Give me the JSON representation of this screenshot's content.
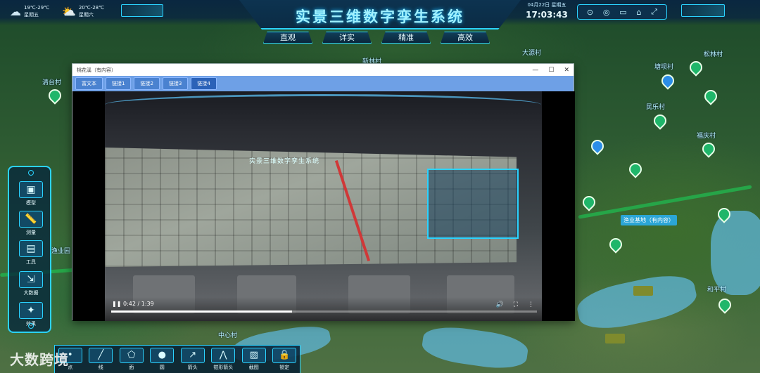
{
  "header": {
    "title": "实景三维数字孪生系统",
    "weather": [
      {
        "temp": "19℃-29℃",
        "day": "星期五",
        "icon": "cloud-icon"
      },
      {
        "temp": "20℃-28℃",
        "day": "星期六",
        "icon": "partly-cloudy-icon"
      }
    ],
    "date": "04月22日 星期五",
    "time": "17:03:43",
    "tools": [
      "map-pin-icon",
      "target-icon",
      "folder-icon",
      "home-icon",
      "fullscreen-icon"
    ],
    "nav_tabs": [
      "直观",
      "详实",
      "精准",
      "高效"
    ]
  },
  "map": {
    "labels": [
      "新林村",
      "大源村",
      "松林村",
      "塘坝村",
      "渔业基地（有内容）",
      "渔业园",
      "中心村",
      "民乐村",
      "福庆村",
      "和平村",
      "清台村"
    ],
    "tags": [
      "渔业基地（有内容）"
    ]
  },
  "popup": {
    "title": "桃花溪（有内容）",
    "tabs": [
      "富文本",
      "链接1",
      "链接2",
      "链接3",
      "链接4"
    ],
    "active_tab": 4,
    "video": {
      "screen_title": "实景三维数字孪生系统",
      "current": "0:42",
      "duration": "1:39",
      "time_label": "0:42 / 1:39",
      "progress": 0.424
    }
  },
  "left_panel": {
    "items": [
      {
        "label": "模型",
        "icon": "cube-icon"
      },
      {
        "label": "测量",
        "icon": "ruler-icon"
      },
      {
        "label": "工具",
        "icon": "toolbox-icon"
      },
      {
        "label": "大数据",
        "icon": "data-icon"
      },
      {
        "label": "效果",
        "icon": "effect-icon"
      }
    ]
  },
  "bottom_bar": {
    "items": [
      {
        "label": "点",
        "icon": "point-icon"
      },
      {
        "label": "线",
        "icon": "line-icon"
      },
      {
        "label": "面",
        "icon": "polygon-icon"
      },
      {
        "label": "圆",
        "icon": "circle-icon"
      },
      {
        "label": "箭头",
        "icon": "arrow-icon"
      },
      {
        "label": "钳形箭头",
        "icon": "pincer-arrow-icon"
      },
      {
        "label": "截图",
        "icon": "screenshot-icon"
      },
      {
        "label": "锁定",
        "icon": "lock-icon"
      }
    ]
  },
  "watermark": "大数跨境"
}
